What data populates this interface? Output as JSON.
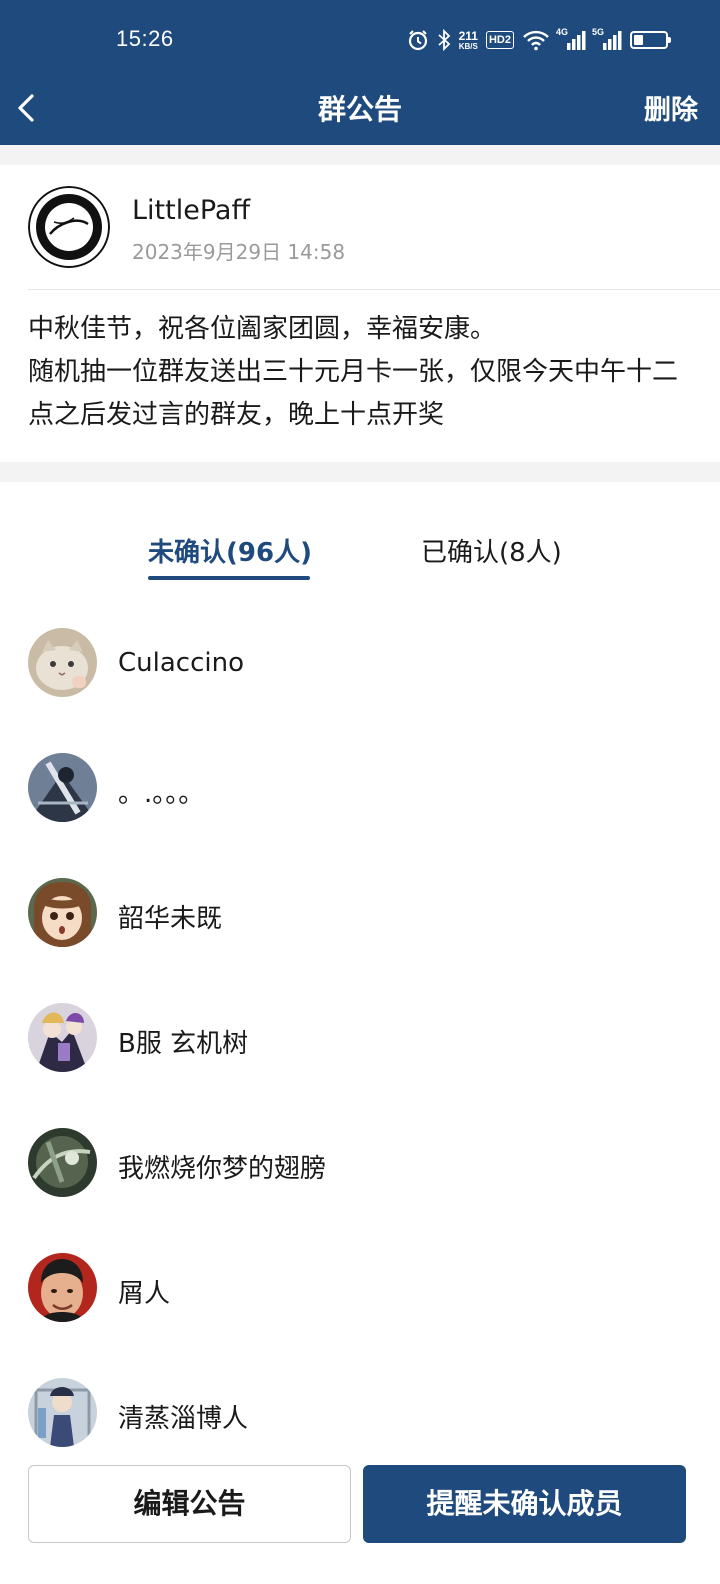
{
  "status_bar": {
    "time": "15:26",
    "network_speed_top": "211",
    "network_speed_unit": "KB/S",
    "hd_label": "HD2",
    "signal1_label": "4G",
    "signal2_label": "5G",
    "battery_level": 0.3
  },
  "nav": {
    "title": "群公告",
    "action_label": "删除"
  },
  "notice": {
    "author": "LittlePaff",
    "time": "2023年9月29日 14:58",
    "body": "中秋佳节，祝各位阖家团圆，幸福安康。\n随机抽一位群友送出三十元月卡一张，仅限今天中午十二点之后发过言的群友，晚上十点开奖"
  },
  "tabs": [
    {
      "label": "未确认(96人)",
      "active": true
    },
    {
      "label": "已确认(8人)",
      "active": false
    }
  ],
  "members": [
    {
      "name": "Culaccino",
      "avatar": "cat-avatar"
    },
    {
      "name": "。.。。。",
      "avatar": "anime-dark-avatar"
    },
    {
      "name": "韶华未既",
      "avatar": "anime-girl-avatar"
    },
    {
      "name": "B服 玄机树",
      "avatar": "anime-purple-avatar"
    },
    {
      "name": "我燃烧你梦的翅膀",
      "avatar": "dark-art-avatar"
    },
    {
      "name": "屑人",
      "avatar": "person-photo-avatar"
    },
    {
      "name": "清蒸淄博人",
      "avatar": "anime-blue-avatar"
    }
  ],
  "buttons": {
    "edit_label": "编辑公告",
    "remind_label": "提醒未确认成员"
  },
  "colors": {
    "brand": "#1e4a7d",
    "background": "#f3f3f3",
    "muted_text": "#9a9a9a"
  }
}
